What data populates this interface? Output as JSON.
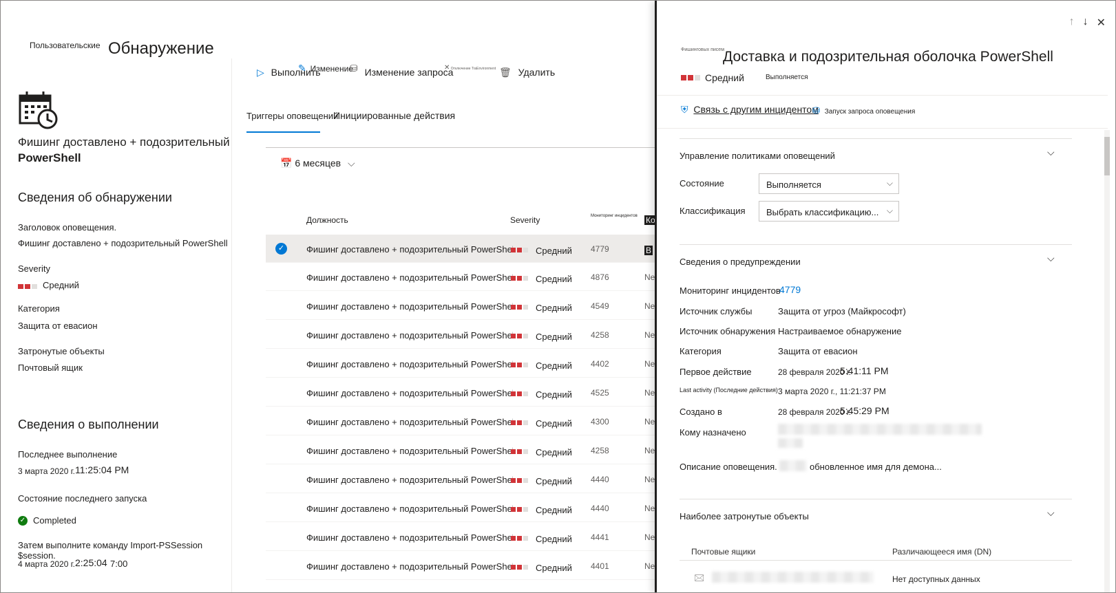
{
  "left": {
    "crumb_small": "Пользовательские",
    "crumb_big": "Обнаружение",
    "rule_title_line1": "Фишинг доставлено + подозрительный",
    "rule_title_line2": "PowerShell",
    "detection_section": "Сведения об обнаружении",
    "alert_title_label": "Заголовок оповещения.",
    "alert_title_value": "Фишинг доставлено + подозрительный PowerShell",
    "severity_label": "Severity",
    "severity_value": "Средний",
    "category_label": "Категория",
    "category_value": "Защита от евасион",
    "impacted_label": "Затронутые объекты",
    "impacted_value": "Почтовый ящик",
    "run_section": "Сведения о выполнении",
    "last_run_label": "Последнее выполнение",
    "last_run_value_date": "3 марта 2020 г.",
    "last_run_value_time": "11:25:04 PM",
    "last_run_status_label": "Состояние последнего запуска",
    "last_run_status_value": "Completed",
    "next_run_label": "Затем выполните команду Import-PSSession $session.",
    "next_run_value_date": "4 марта 2020 г.",
    "next_run_value_time": "2:25:04",
    "next_run_value_extra": "7:00"
  },
  "toolbar": {
    "run": "Выполнить",
    "edit": "Изменение",
    "edit_query": "Изменение запроса",
    "small_overlay": "Отключение TraEnvironment",
    "delete": "Удалить"
  },
  "tabs": {
    "alerts": "Триггеры оповещений",
    "actions": "Инициированные действия"
  },
  "filter": {
    "period": "6 месяцев"
  },
  "table": {
    "col_title": "Должность",
    "col_severity": "Severity",
    "col_incident": "Мониторинг инцидентов",
    "col_status": "Ко",
    "rows": [
      {
        "title": "Фишинг доставлено + подозрительный PowerShell",
        "severity": "Средний",
        "incident": "4779",
        "status": "В"
      },
      {
        "title": "Фишинг доставлено + подозрительный PowerShell",
        "severity": "Средний",
        "incident": "4876",
        "status": "Ne"
      },
      {
        "title": "Фишинг доставлено + подозрительный PowerShell",
        "severity": "Средний",
        "incident": "4549",
        "status": "Ne"
      },
      {
        "title": "Фишинг доставлено + подозрительный PowerShell",
        "severity": "Средний",
        "incident": "4258",
        "status": "Ne"
      },
      {
        "title": "Фишинг доставлено + подозрительный PowerShell",
        "severity": "Средний",
        "incident": "4402",
        "status": "Ne"
      },
      {
        "title": "Фишинг доставлено + подозрительный PowerShell",
        "severity": "Средний",
        "incident": "4525",
        "status": "Ne"
      },
      {
        "title": "Фишинг доставлено + подозрительный PowerShell",
        "severity": "Средний",
        "incident": "4300",
        "status": "Ne"
      },
      {
        "title": "Фишинг доставлено + подозрительный PowerShell",
        "severity": "Средний",
        "incident": "4258",
        "status": "Ne"
      },
      {
        "title": "Фишинг доставлено + подозрительный PowerShell",
        "severity": "Средний",
        "incident": "4440",
        "status": "Ne"
      },
      {
        "title": "Фишинг доставлено + подозрительный PowerShell",
        "severity": "Средний",
        "incident": "4440",
        "status": "Ne"
      },
      {
        "title": "Фишинг доставлено + подозрительный PowerShell",
        "severity": "Средний",
        "incident": "4441",
        "status": "Ne"
      },
      {
        "title": "Фишинг доставлено + подозрительный PowerShell",
        "severity": "Средний",
        "incident": "4401",
        "status": "Ne"
      }
    ]
  },
  "panel": {
    "tiny_caption": "Фишинговых писем",
    "title": "Доставка и подозрительная оболочка PowerShell",
    "severity": "Средний",
    "status": "Выполняется",
    "action_link_incident": "Связь с другим инцидентом",
    "action_run_query": "Запуск запроса оповещения",
    "policy_section": "Управление политиками оповещений",
    "state_label": "Состояние",
    "state_value": "Выполняется",
    "classification_label": "Классификация",
    "classification_value": "Выбрать классификацию...",
    "alert_details_section": "Сведения о предупреждении",
    "details": {
      "incident_label": "Мониторинг инцидентов",
      "incident_value": "4779",
      "service_source_label": "Источник службы",
      "service_source_value": "Защита от угроз (Майкрософт)",
      "detection_source_label": "Источник обнаружения",
      "detection_source_value": "Настраиваемое обнаружение",
      "category_label": "Категория",
      "category_value": "Защита от евасион",
      "first_activity_label": "Первое действие",
      "first_activity_date": "28 февраля 2020 г.",
      "first_activity_time": "5:41:11 PM",
      "last_activity_label": "Last activity (Последние действия)",
      "last_activity_value": "3 марта 2020 г., 11:21:37 PM",
      "created_label": "Создано в",
      "created_date": "28 февраля 2020 г.",
      "created_time": "5:45:29 PM",
      "assigned_label": "Кому назначено",
      "description_label": "Описание оповещения.",
      "description_value": "обновленное имя для демона..."
    },
    "impacted_section": "Наиболее затронутые объекты",
    "col_mailboxes": "Почтовые ящики",
    "col_dn": "Различающееся имя (DN)",
    "dn_value": "Нет доступных данных"
  },
  "colors": {
    "accent": "#0078d4",
    "severity": "#d13438",
    "success": "#107c10"
  }
}
